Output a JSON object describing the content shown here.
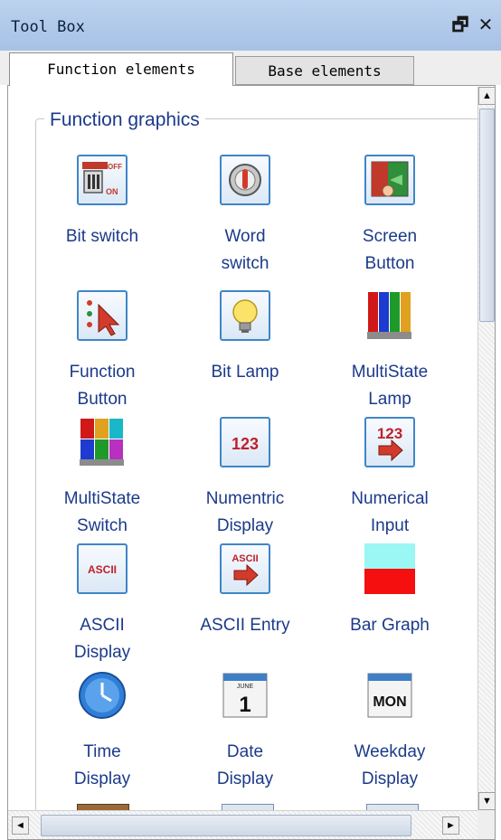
{
  "window": {
    "title": "Tool Box",
    "float_glyph": "🗗",
    "close_glyph": "✕"
  },
  "tabs": [
    {
      "label": "Function elements",
      "active": true
    },
    {
      "label": "Base elements",
      "active": false
    }
  ],
  "group": {
    "title": "Function graphics"
  },
  "items": [
    {
      "label": "Bit switch",
      "icon": "bit-switch-icon"
    },
    {
      "label": "Word switch",
      "icon": "word-switch-icon"
    },
    {
      "label": "Screen Button",
      "icon": "screen-button-icon"
    },
    {
      "label": "Function Button",
      "icon": "function-button-icon"
    },
    {
      "label": "Bit Lamp",
      "icon": "bit-lamp-icon"
    },
    {
      "label": "MultiState Lamp",
      "icon": "multistate-lamp-icon"
    },
    {
      "label": "MultiState Switch",
      "icon": "multistate-switch-icon"
    },
    {
      "label": "Numentric Display",
      "icon": "numeric-display-icon"
    },
    {
      "label": "Numerical Input",
      "icon": "numerical-input-icon"
    },
    {
      "label": "ASCII Display",
      "icon": "ascii-display-icon"
    },
    {
      "label": "ASCII Entry",
      "icon": "ascii-entry-icon"
    },
    {
      "label": "Bar Graph",
      "icon": "bar-graph-icon"
    },
    {
      "label": "Time Display",
      "icon": "time-display-icon"
    },
    {
      "label": "Date Display",
      "icon": "date-display-icon"
    },
    {
      "label": "Weekday Display",
      "icon": "weekday-display-icon"
    }
  ],
  "icon_text": {
    "off": "OFF",
    "on": "ON",
    "num": "123",
    "ascii": "ASCII",
    "month": "JUNE",
    "day": "1",
    "weekday": "MON"
  },
  "scrollbars": {
    "up": "▲",
    "down": "▼",
    "left": "◄",
    "right": "►"
  },
  "colors": {
    "titlebar": "#a7c1e6",
    "label_text": "#1b3a8a",
    "icon_frame": "#3f86c6"
  }
}
